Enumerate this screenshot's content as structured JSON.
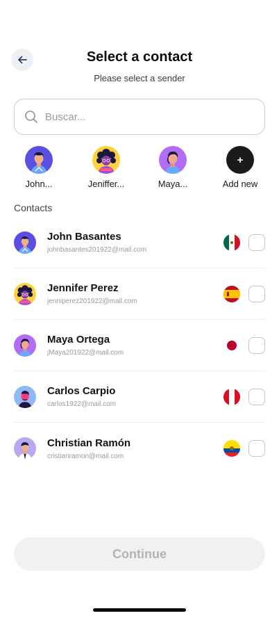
{
  "header": {
    "title": "Select a contact",
    "subtitle": "Please select a sender",
    "back_icon": "arrow-left-icon"
  },
  "search": {
    "placeholder": "Buscar...",
    "value": "",
    "icon": "search-icon"
  },
  "recent": [
    {
      "label": "John...",
      "avatar": "avatar-john"
    },
    {
      "label": "Jeniffer...",
      "avatar": "avatar-jennifer"
    },
    {
      "label": "Maya...",
      "avatar": "avatar-maya"
    },
    {
      "label": "Add new",
      "icon": "plus-icon",
      "symbol": "+"
    }
  ],
  "contacts_label": "Contacts",
  "contacts": [
    {
      "name": "John Basantes",
      "email": "johnbasantes201922@mail.com",
      "flag": "mexico-flag",
      "checked": false
    },
    {
      "name": "Jennifer Perez",
      "email": "jenniperez201922@mail.com",
      "flag": "spain-flag",
      "checked": false
    },
    {
      "name": "Maya Ortega",
      "email": "jMaya201922@mail.com",
      "flag": "japan-flag",
      "checked": false
    },
    {
      "name": "Carlos Carpio",
      "email": "carlos1922@mail.com",
      "flag": "peru-flag",
      "checked": false
    },
    {
      "name": "Christian Ramón",
      "email": "cristianramon@mail.com",
      "flag": "ecuador-flag",
      "checked": false
    }
  ],
  "continue_label": "Continue",
  "colors": {
    "accent": "#1b1b1d",
    "disabled_button_bg": "#f1f1f2",
    "disabled_button_text": "#b4b4b6",
    "border": "#c9c9cc"
  }
}
